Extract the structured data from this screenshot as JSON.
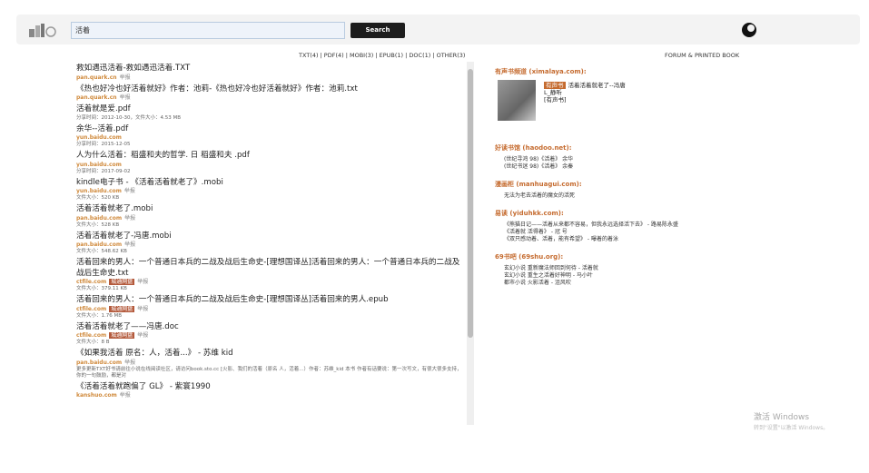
{
  "search": {
    "value": "活着",
    "button": "Search"
  },
  "filters": "TXT(4) | PDF(4) | MOBI(3) | EPUB(1) | DOC(1) | OTHER(3)",
  "results": [
    {
      "title": "救如遇迅活着-救如遇迅活着.TXT",
      "source": "pan.quark.cn",
      "tag": "",
      "sub": "举报",
      "meta": ""
    },
    {
      "title": "《热也好冷也好活着就好》作者：池莉-《热也好冷也好活着就好》作者：池莉.txt",
      "source": "pan.quark.cn",
      "tag": "",
      "sub": "举报",
      "meta": ""
    },
    {
      "title": "活着就是爱.pdf",
      "source": "",
      "tag": "",
      "sub": "",
      "meta": "分享时间：2012-10-30，文件大小：4.53 MB"
    },
    {
      "title": "余华--活着.pdf",
      "source": "yun.baidu.com",
      "tag": "",
      "sub": "",
      "meta": "分享时间：2015-12-05"
    },
    {
      "title": "人为什么活着：稻盛和夫的哲学. 日 稻盛和夫 .pdf",
      "source": "yun.baidu.com",
      "tag": "",
      "sub": "",
      "meta": "分享时间：2017-09-02"
    },
    {
      "title": "kindle电子书 - 《活着活着就老了》.mobi",
      "source": "yun.baidu.com",
      "tag": "",
      "sub": "举报",
      "meta": "文件大小：520 KB"
    },
    {
      "title": "活着活着就老了.mobi",
      "source": "pan.baidu.com",
      "tag": "",
      "sub": "举报",
      "meta": "文件大小：528 KB"
    },
    {
      "title": "活着活着就老了-冯唐.mobi",
      "source": "pan.baidu.com",
      "tag": "",
      "sub": "举报",
      "meta": "文件大小：548.62 KB"
    },
    {
      "title": "活着回来的男人：一个普通日本兵的二战及战后生命史-[理想国译丛]活着回来的男人：一个普通日本兵的二战及战后生命史.txt",
      "source": "ctfile.com",
      "tag": "城通网盘",
      "sub": "举报",
      "meta": "文件大小：379.11 KB"
    },
    {
      "title": "活着回来的男人：一个普通日本兵的二战及战后生命史-[理想国译丛]活着回来的男人.epub",
      "source": "ctfile.com",
      "tag": "城通网盘",
      "sub": "举报",
      "meta": "文件大小：1.76 MB"
    },
    {
      "title": "活着活着就老了——冯唐.doc",
      "source": "ctfile.com",
      "tag": "城通网盘",
      "sub": "举报",
      "meta": "文件大小：8 B"
    },
    {
      "title": "《如果我活着 原名：人，活着...》 - 苏维 kid",
      "source": "pan.baidu.com",
      "tag": "",
      "sub": "举报",
      "meta": "更多更新TXT好书请前往小说在线阅读社区，请访问book.sto.cc [火影、我们的活着（原名 人，活着...）作者：苏维_kid 本书 作者有话要说：第一次写文，有很大很多支持，你的一句鼓励，都是对"
    },
    {
      "title": "《活着活着就跑偏了 GL》 - 紫寰1990",
      "source": "kanshuo.com",
      "tag": "",
      "sub": "举报",
      "meta": ""
    }
  ],
  "right": {
    "header": "FORUM & PRINTED BOOK",
    "ximalaya_title": "有声书频道 (ximalaya.com):",
    "ximalaya_book": {
      "badge": "有声书",
      "title": "活着活着就老了--冯唐",
      "author": "L_静听",
      "tag": "[有声书]"
    },
    "haodoo_title": "好读书馆 (haodoo.net):",
    "haodoo_lines": [
      "(世纪寻鸿 98)《活着》 余华",
      "(世纪书迷 98)《活着》 余秦"
    ],
    "manhuagui_title": "漫画柜 (manhuagui.com):",
    "manhuagui_lines": [
      "无法为老去活着的魔女的活死"
    ],
    "yidu_title": "易读 (yiduhkk.com):",
    "yidu_lines": [
      "《熊猫日记——活着从来都不容易，但我永远选择活下去》 - 路易陈永盛",
      "《活着就 活得着》 - 冠 号",
      "《双只感动着、活着，能有希望》 - 曝着的着泳"
    ],
    "sixnine_title": "69书吧 (69shu.org):",
    "sixnine_lines": [
      "玄幻小说 重新魔法师回到何待 - 活着就",
      "玄幻小说 重生之活着好神明 - 马小叶",
      "都市小说 火影活着 - 沮风吹"
    ]
  },
  "watermark": {
    "line1": "激活 Windows",
    "line2": "转到\"设置\"以激活 Windows。"
  }
}
